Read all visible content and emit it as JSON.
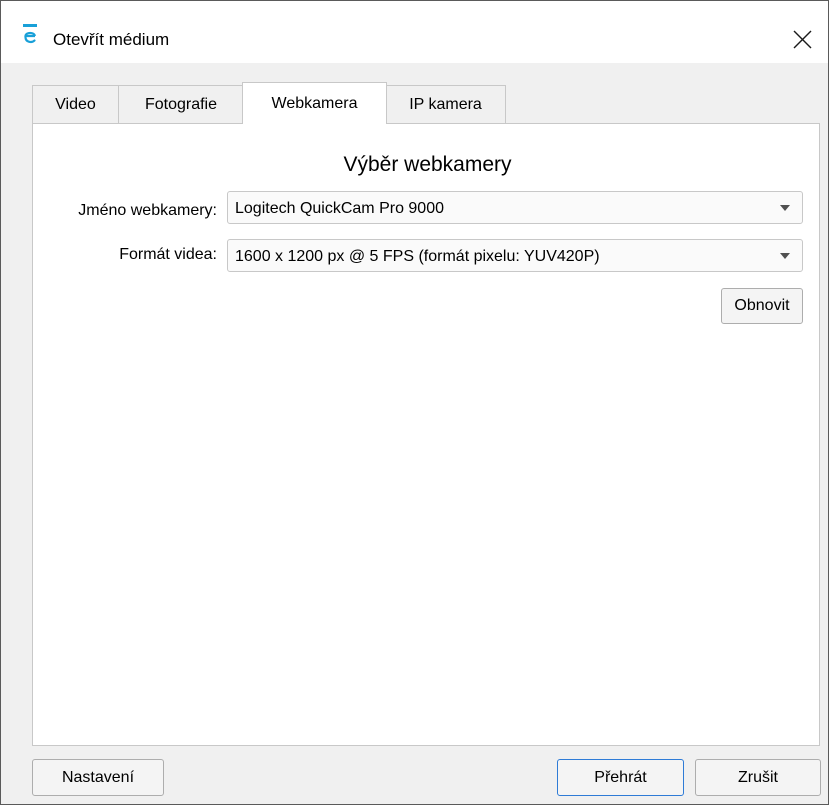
{
  "window": {
    "title": "Otevřít médium"
  },
  "tabs": [
    {
      "label": "Video",
      "active": false
    },
    {
      "label": "Fotografie",
      "active": false
    },
    {
      "label": "Webkamera",
      "active": true
    },
    {
      "label": "IP kamera",
      "active": false
    }
  ],
  "webcam": {
    "section_title": "Výběr webkamery",
    "name_label": "Jméno webkamery:",
    "name_value": "Logitech QuickCam Pro 9000",
    "format_label": "Formát videa:",
    "format_value": "1600 x 1200 px @ 5 FPS (formát pixelu: YUV420P)",
    "refresh_label": "Obnovit"
  },
  "footer": {
    "settings_label": "Nastavení",
    "play_label": "Přehrát",
    "cancel_label": "Zrušit"
  },
  "icons": {
    "app": "app-logo-icon",
    "close": "close-icon",
    "dropdown": "chevron-down-icon"
  },
  "colors": {
    "accent": "#0078d7",
    "default_button_border": "#2e7bd6"
  }
}
